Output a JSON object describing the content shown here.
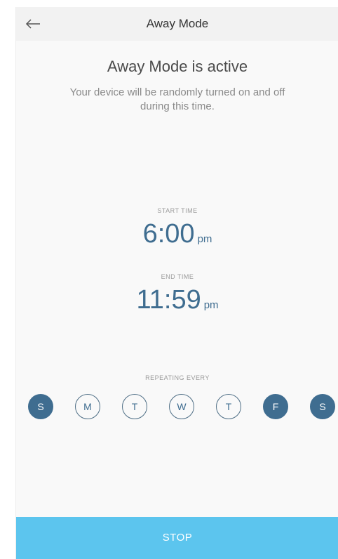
{
  "header": {
    "title": "Away Mode",
    "back_icon": "arrow-left-icon"
  },
  "status": {
    "title": "Away Mode is active",
    "description": "Your device will be randomly turned on and off during this time."
  },
  "schedule": {
    "start_label": "START TIME",
    "start_time": "6:00",
    "start_ampm": "pm",
    "end_label": "END TIME",
    "end_time": "11:59",
    "end_ampm": "pm",
    "repeat_label": "REPEATING EVERY"
  },
  "days": [
    {
      "letter": "S",
      "selected": true
    },
    {
      "letter": "M",
      "selected": false
    },
    {
      "letter": "T",
      "selected": false
    },
    {
      "letter": "W",
      "selected": false
    },
    {
      "letter": "T",
      "selected": false
    },
    {
      "letter": "F",
      "selected": true
    },
    {
      "letter": "S",
      "selected": true
    }
  ],
  "actions": {
    "stop_label": "STOP"
  },
  "colors": {
    "accent": "#3f6d90",
    "stop_button": "#5cc5ee"
  }
}
